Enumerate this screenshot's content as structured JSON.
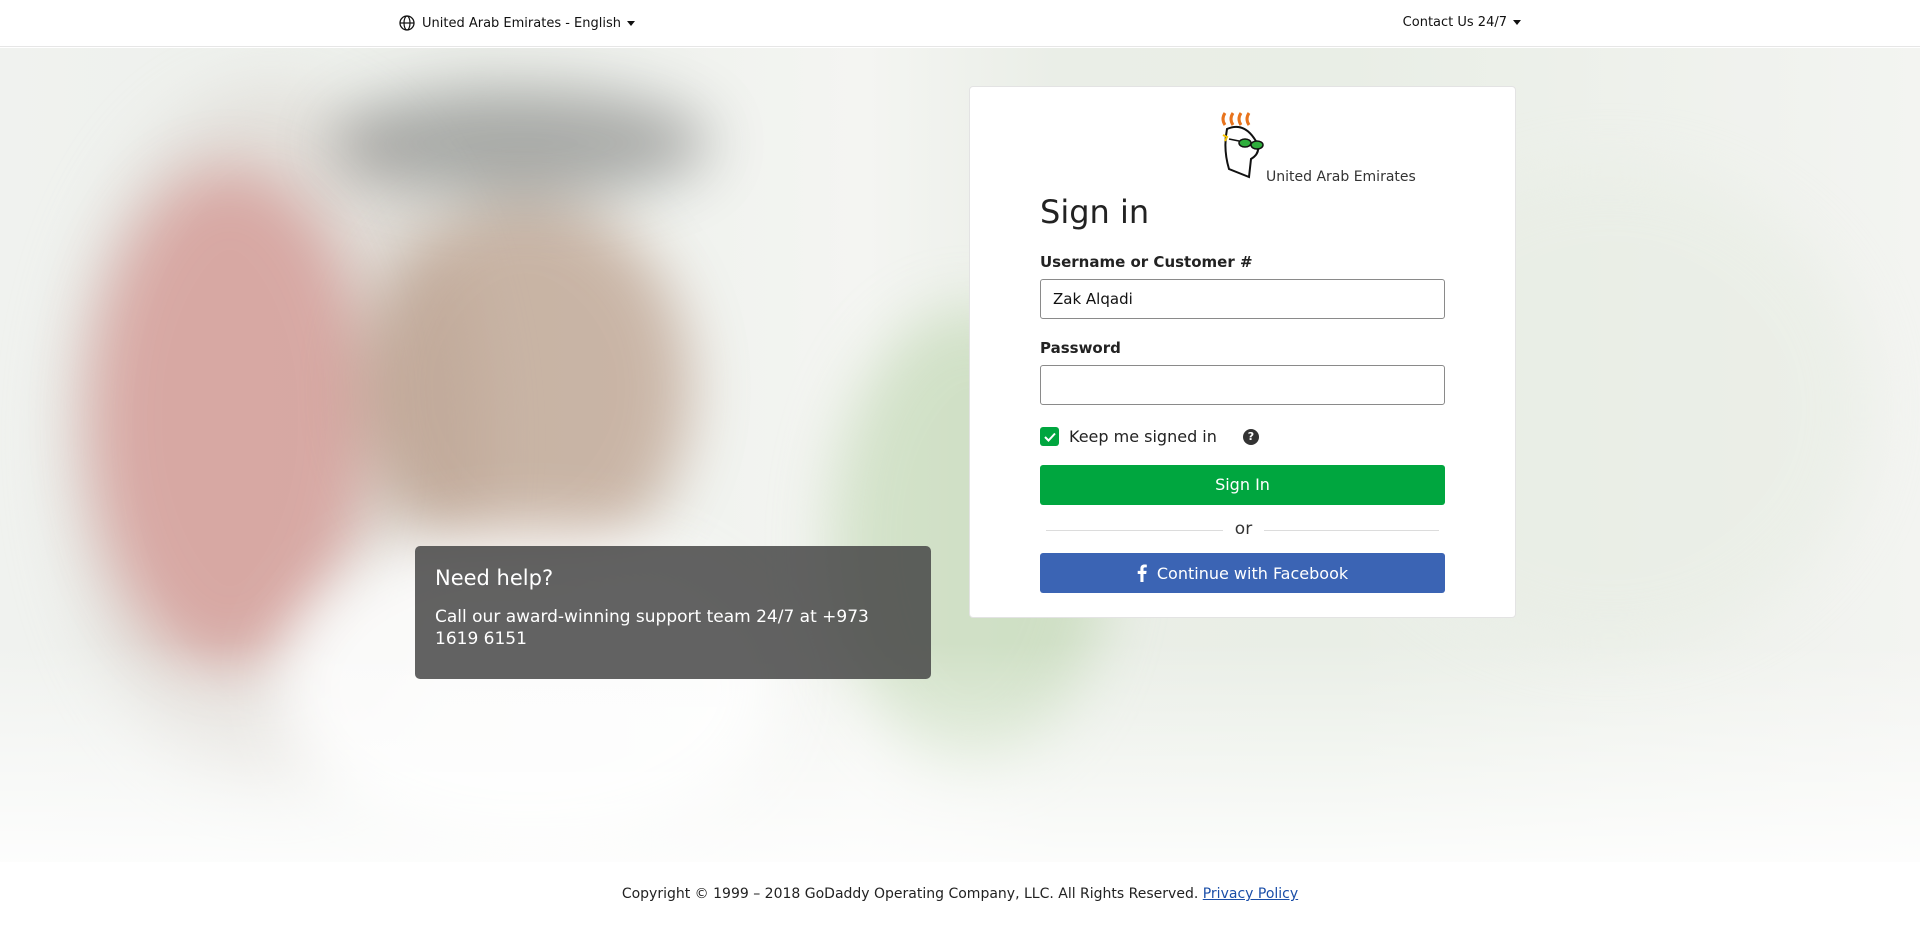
{
  "header": {
    "language_selector": "United Arab Emirates - English",
    "contact": "Contact Us 24/7"
  },
  "help_box": {
    "title": "Need help?",
    "text": "Call our award-winning support team 24/7 at +973 1619 6151"
  },
  "signin": {
    "region": "United Arab Emirates",
    "title": "Sign in",
    "username_label": "Username or Customer #",
    "username_value": "Zak Alqadi",
    "password_label": "Password",
    "password_value": "",
    "keep_signed_in_label": "Keep me signed in",
    "keep_signed_in_checked": true,
    "help_icon_text": "?",
    "sign_in_button": "Sign In",
    "or_text": "or",
    "facebook_button": "Continue with Facebook"
  },
  "footer": {
    "copyright": "Copyright © 1999 – 2018 GoDaddy Operating Company, LLC. All Rights Reserved.",
    "privacy_link": "Privacy Policy"
  },
  "colors": {
    "primary_green": "#00a63f",
    "facebook_blue": "#3b64b4",
    "link_blue": "#1a4ea8"
  },
  "icons": [
    "globe-icon",
    "caret-down-icon",
    "checkmark-icon",
    "help-icon",
    "facebook-icon",
    "godaddy-logo"
  ]
}
